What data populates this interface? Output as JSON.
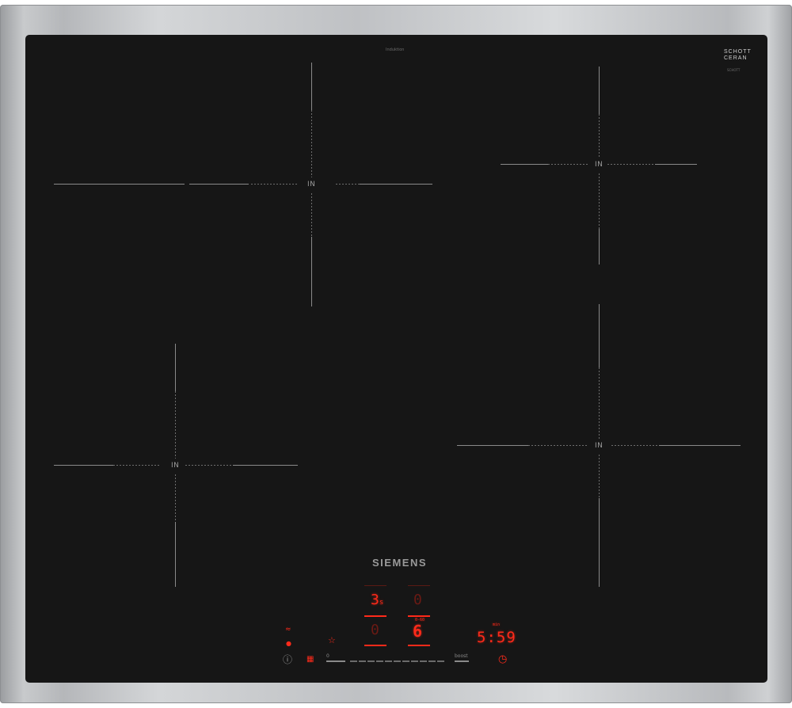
{
  "brand": {
    "name": "SIEMENS",
    "model": "Induktion"
  },
  "ceramic_logo": {
    "line1": "SCHOTT",
    "line2": "CERAN",
    "sub": "SCHOTT"
  },
  "zones": [
    {
      "id": "front-left",
      "label": "IN"
    },
    {
      "id": "rear-right",
      "label": "IN"
    },
    {
      "id": "rear-left",
      "label": "IN"
    },
    {
      "id": "front-right",
      "label": "IN"
    }
  ],
  "controls": {
    "zone_displays": [
      {
        "id": "zone-a",
        "value": "3",
        "sub": "s",
        "active": true
      },
      {
        "id": "zone-b",
        "value": "0",
        "active": false
      },
      {
        "id": "zone-c",
        "value": "0",
        "active": false
      },
      {
        "id": "zone-d",
        "value": "6",
        "sub": "0-60",
        "active": true
      }
    ],
    "timer": {
      "value": "5:59",
      "unit": "min"
    },
    "slider": {
      "min_label": "0",
      "max_label": "boost"
    },
    "icons": [
      "wifi-icon",
      "power-dot-icon",
      "info-icon",
      "lock-icon",
      "favorite-icon",
      "timer-clock-icon"
    ],
    "accent_color": "#ff2a1a"
  }
}
